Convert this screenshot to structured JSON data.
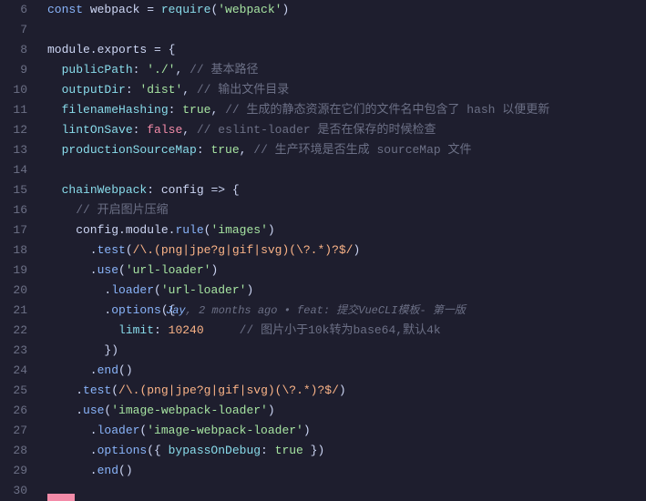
{
  "editor": {
    "background": "#1e1e2e",
    "lines": [
      {
        "num": "6",
        "tokens": [
          {
            "type": "kw",
            "text": "const "
          },
          {
            "type": "plain",
            "text": "webpack = "
          },
          {
            "type": "func-name",
            "text": "require"
          },
          {
            "type": "punc",
            "text": "("
          },
          {
            "type": "str",
            "text": "'webpack'"
          },
          {
            "type": "punc",
            "text": ")"
          }
        ]
      },
      {
        "num": "7",
        "tokens": []
      },
      {
        "num": "8",
        "tokens": [
          {
            "type": "plain",
            "text": "module.exports = {"
          }
        ]
      },
      {
        "num": "9",
        "tokens": [
          {
            "type": "plain",
            "text": "  "
          },
          {
            "type": "prop",
            "text": "publicPath"
          },
          {
            "type": "plain",
            "text": ": "
          },
          {
            "type": "str",
            "text": "'./'"
          },
          {
            "type": "plain",
            "text": ", "
          },
          {
            "type": "comment",
            "text": "// 基本路径"
          }
        ]
      },
      {
        "num": "10",
        "tokens": [
          {
            "type": "plain",
            "text": "  "
          },
          {
            "type": "prop",
            "text": "outputDir"
          },
          {
            "type": "plain",
            "text": ": "
          },
          {
            "type": "str",
            "text": "'dist'"
          },
          {
            "type": "plain",
            "text": ", "
          },
          {
            "type": "comment",
            "text": "// 输出文件目录"
          }
        ]
      },
      {
        "num": "11",
        "tokens": [
          {
            "type": "plain",
            "text": "  "
          },
          {
            "type": "prop",
            "text": "filenameHashing"
          },
          {
            "type": "plain",
            "text": ": "
          },
          {
            "type": "bool-t",
            "text": "true"
          },
          {
            "type": "plain",
            "text": ", "
          },
          {
            "type": "comment",
            "text": "// 生成的静态资源在它们的文件名中包含了 hash 以便更新"
          }
        ]
      },
      {
        "num": "12",
        "tokens": [
          {
            "type": "plain",
            "text": "  "
          },
          {
            "type": "prop",
            "text": "lintOnSave"
          },
          {
            "type": "plain",
            "text": ": "
          },
          {
            "type": "bool-f",
            "text": "false"
          },
          {
            "type": "plain",
            "text": ", "
          },
          {
            "type": "comment",
            "text": "// eslint-loader 是否在保存的时候检查"
          }
        ]
      },
      {
        "num": "13",
        "tokens": [
          {
            "type": "plain",
            "text": "  "
          },
          {
            "type": "prop",
            "text": "productionSourceMap"
          },
          {
            "type": "plain",
            "text": ": "
          },
          {
            "type": "bool-t",
            "text": "true"
          },
          {
            "type": "plain",
            "text": ", "
          },
          {
            "type": "comment",
            "text": "// 生产环境是否生成 sourceMap 文件"
          }
        ]
      },
      {
        "num": "14",
        "tokens": []
      },
      {
        "num": "15",
        "tokens": [
          {
            "type": "plain",
            "text": "  "
          },
          {
            "type": "prop",
            "text": "chainWebpack"
          },
          {
            "type": "plain",
            "text": ": config "
          },
          {
            "type": "arrow",
            "text": "=>"
          },
          {
            "type": "plain",
            "text": " {"
          }
        ]
      },
      {
        "num": "16",
        "tokens": [
          {
            "type": "plain",
            "text": "    "
          },
          {
            "type": "comment",
            "text": "// 开启图片压缩"
          }
        ]
      },
      {
        "num": "17",
        "tokens": [
          {
            "type": "plain",
            "text": "    config.module."
          },
          {
            "type": "method",
            "text": "rule"
          },
          {
            "type": "punc",
            "text": "("
          },
          {
            "type": "str",
            "text": "'images'"
          },
          {
            "type": "punc",
            "text": ")"
          }
        ]
      },
      {
        "num": "18",
        "tokens": [
          {
            "type": "plain",
            "text": "      ."
          },
          {
            "type": "method",
            "text": "test"
          },
          {
            "type": "punc",
            "text": "("
          },
          {
            "type": "regex",
            "text": "/\\.(png|jpe?g|gif|svg)(\\?.*)?$/"
          },
          {
            "type": "punc",
            "text": ")"
          }
        ]
      },
      {
        "num": "19",
        "tokens": [
          {
            "type": "plain",
            "text": "      ."
          },
          {
            "type": "method",
            "text": "use"
          },
          {
            "type": "punc",
            "text": "("
          },
          {
            "type": "str",
            "text": "'url-loader'"
          },
          {
            "type": "punc",
            "text": ")"
          }
        ]
      },
      {
        "num": "20",
        "tokens": [
          {
            "type": "plain",
            "text": "        ."
          },
          {
            "type": "method",
            "text": "loader"
          },
          {
            "type": "punc",
            "text": "("
          },
          {
            "type": "str",
            "text": "'url-loader'"
          },
          {
            "type": "punc",
            "text": ")"
          }
        ]
      },
      {
        "num": "21",
        "tokens": [
          {
            "type": "plain",
            "text": "        ."
          },
          {
            "type": "method",
            "text": "options"
          },
          {
            "type": "punc",
            "text": "({"
          }
        ],
        "blame": true,
        "blame_author": "Jay",
        "blame_time": "2 months ago",
        "blame_sep": " • ",
        "blame_msg": "feat: 提交VueCLI模板- 第一版"
      },
      {
        "num": "22",
        "tokens": [
          {
            "type": "plain",
            "text": "          "
          },
          {
            "type": "prop",
            "text": "limit"
          },
          {
            "type": "plain",
            "text": ": "
          },
          {
            "type": "num",
            "text": "10240"
          },
          {
            "type": "plain",
            "text": "     "
          },
          {
            "type": "comment",
            "text": "// 图片小于10k转为base64,默认4k"
          }
        ]
      },
      {
        "num": "23",
        "tokens": [
          {
            "type": "plain",
            "text": "        })"
          }
        ]
      },
      {
        "num": "24",
        "tokens": [
          {
            "type": "plain",
            "text": "      ."
          },
          {
            "type": "method",
            "text": "end"
          },
          {
            "type": "punc",
            "text": "()"
          }
        ],
        "caret": true
      },
      {
        "num": "25",
        "tokens": [
          {
            "type": "plain",
            "text": "    ."
          },
          {
            "type": "method",
            "text": "test"
          },
          {
            "type": "punc",
            "text": "("
          },
          {
            "type": "regex",
            "text": "/\\.(png|jpe?g|gif|svg)(\\?.*)?$/"
          },
          {
            "type": "punc",
            "text": ")"
          }
        ]
      },
      {
        "num": "26",
        "tokens": [
          {
            "type": "plain",
            "text": "    ."
          },
          {
            "type": "method",
            "text": "use"
          },
          {
            "type": "punc",
            "text": "("
          },
          {
            "type": "str",
            "text": "'image-webpack-loader'"
          },
          {
            "type": "punc",
            "text": ")"
          }
        ]
      },
      {
        "num": "27",
        "tokens": [
          {
            "type": "plain",
            "text": "      ."
          },
          {
            "type": "method",
            "text": "loader"
          },
          {
            "type": "punc",
            "text": "("
          },
          {
            "type": "str",
            "text": "'image-webpack-loader'"
          },
          {
            "type": "punc",
            "text": ")"
          }
        ]
      },
      {
        "num": "28",
        "tokens": [
          {
            "type": "plain",
            "text": "      ."
          },
          {
            "type": "method",
            "text": "options"
          },
          {
            "type": "punc",
            "text": "({ "
          },
          {
            "type": "prop",
            "text": "bypassOnDebug"
          },
          {
            "type": "plain",
            "text": ": "
          },
          {
            "type": "bool-t",
            "text": "true"
          },
          {
            "type": "punc",
            "text": " })"
          }
        ]
      },
      {
        "num": "29",
        "tokens": [
          {
            "type": "plain",
            "text": "      ."
          },
          {
            "type": "method",
            "text": "end"
          },
          {
            "type": "punc",
            "text": "()"
          }
        ]
      },
      {
        "num": "30",
        "tokens": [],
        "red_marker": true
      }
    ]
  }
}
